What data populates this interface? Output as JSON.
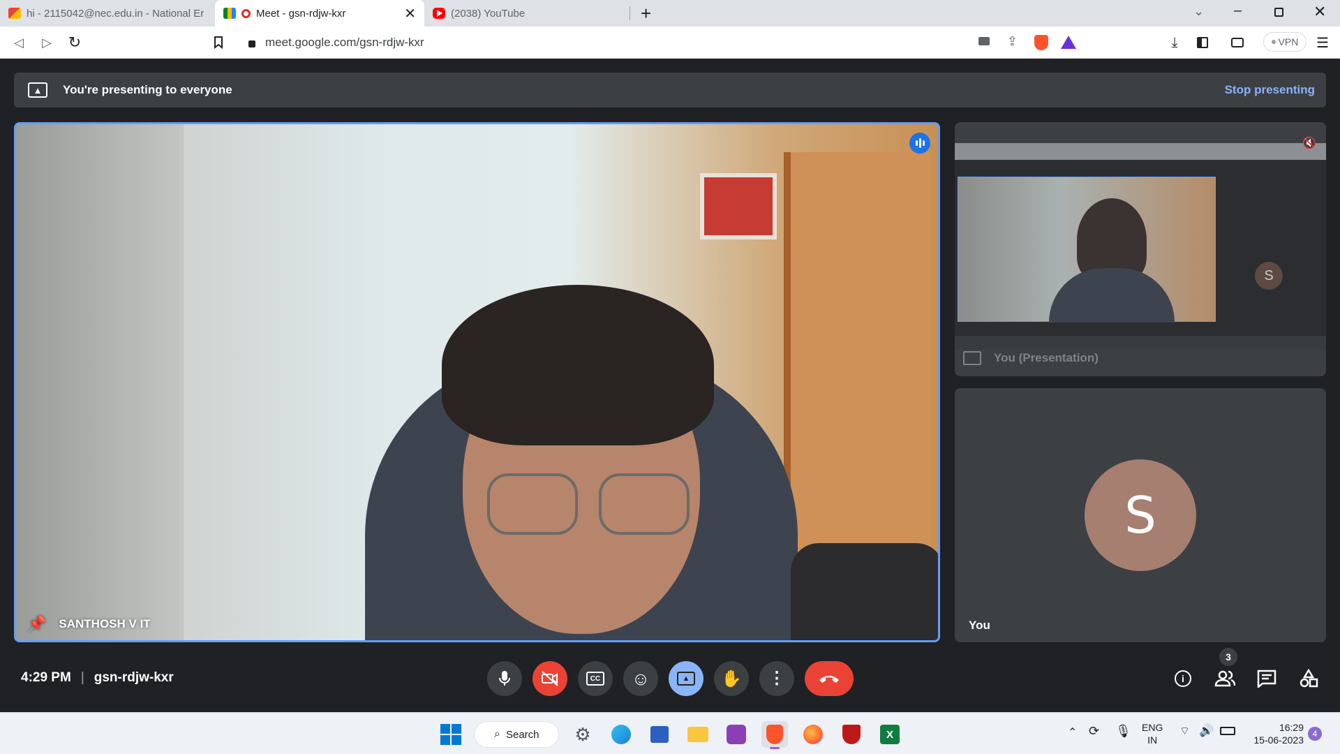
{
  "browser": {
    "tabs": [
      {
        "title": "hi - 2115042@nec.edu.in - National Er",
        "icon": "gmail-icon",
        "active": false
      },
      {
        "title": "Meet - gsn-rdjw-kxr",
        "icon": "meet-icon",
        "active": true
      },
      {
        "title": "(2038) YouTube",
        "icon": "youtube-icon",
        "active": false
      }
    ],
    "url": "meet.google.com/gsn-rdjw-kxr",
    "vpn_label": "VPN"
  },
  "meet": {
    "banner_text": "You're presenting to everyone",
    "stop_presenting": "Stop presenting",
    "main_participant": "SANTHOSH V IT",
    "presentation_tile_label": "You (Presentation)",
    "self_tile_label": "You",
    "avatar_initial": "S",
    "clock": "4:29 PM",
    "meeting_code": "gsn-rdjw-kxr",
    "participant_count": "3",
    "colors": {
      "accent": "#8ab4f8",
      "end_call": "#ea4335",
      "avatar": "#a67f70",
      "present_active": "#8ab4f8"
    }
  },
  "taskbar": {
    "search_label": "Search",
    "lang_top": "ENG",
    "lang_bottom": "IN",
    "time": "16:29",
    "date": "15-06-2023",
    "notification_count": "4"
  }
}
